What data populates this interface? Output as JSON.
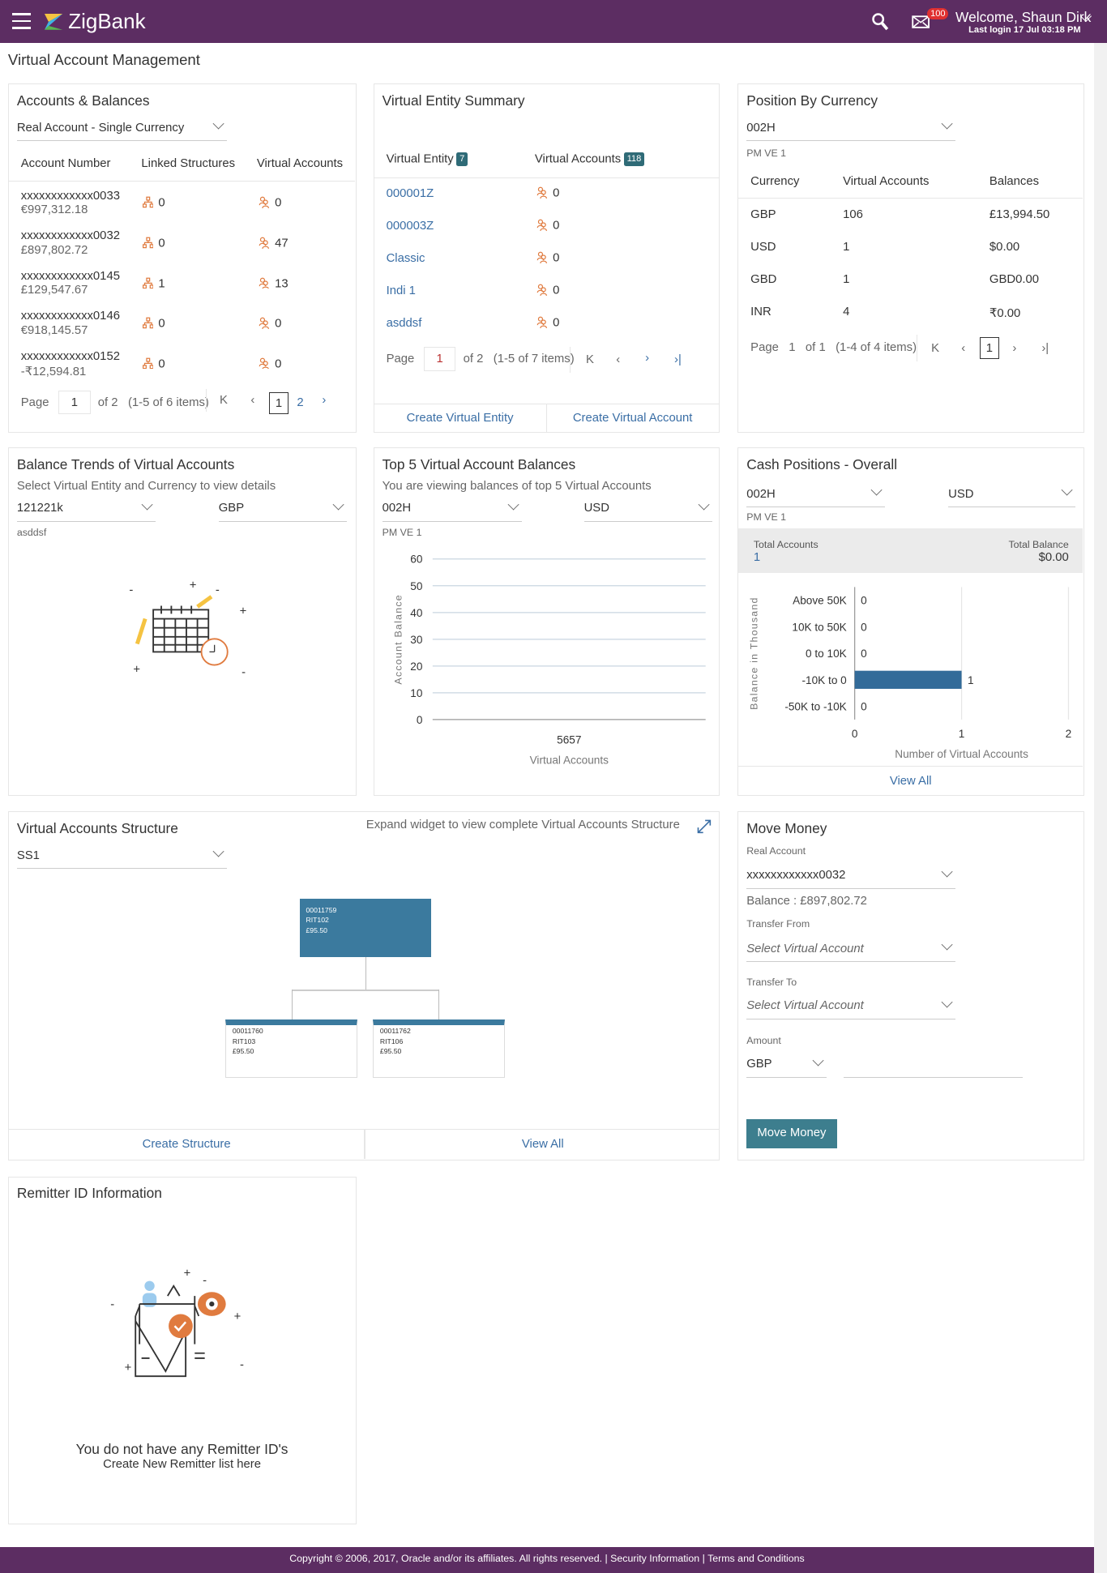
{
  "header": {
    "brand": "ZigBank",
    "welcome": "Welcome, Shaun Dirk",
    "last_login": "Last login 17 Jul 03:18 PM",
    "mail_badge": "100",
    "icons": [
      "menu-icon",
      "search-icon",
      "mail-icon",
      "chevron-down-icon"
    ]
  },
  "page_title": "Virtual Account Management",
  "colors": {
    "header": "#5c2d62",
    "accent": "#3d7e8e",
    "link": "#3a6ea5",
    "bar": "#336b99",
    "node": "#3b7a9e",
    "icon": "#e07b3f"
  },
  "accounts": {
    "title": "Accounts & Balances",
    "filter": "Real Account - Single Currency",
    "columns": [
      "Account Number",
      "Linked Structures",
      "Virtual Accounts"
    ],
    "rows": [
      {
        "account": "xxxxxxxxxxxx0033",
        "balance": "€997,312.18",
        "linked": "0",
        "virtual": "0"
      },
      {
        "account": "xxxxxxxxxxxx0032",
        "balance": "£897,802.72",
        "linked": "0",
        "virtual": "47"
      },
      {
        "account": "xxxxxxxxxxxx0145",
        "balance": "£129,547.67",
        "linked": "1",
        "virtual": "13"
      },
      {
        "account": "xxxxxxxxxxxx0146",
        "balance": "€918,145.57",
        "linked": "0",
        "virtual": "0"
      },
      {
        "account": "xxxxxxxxxxxx0152",
        "balance": "-₹12,594.81",
        "linked": "0",
        "virtual": "0"
      }
    ],
    "pager": {
      "label": "Page",
      "page": "1",
      "of": "of 2",
      "items": "(1-5 of 6 items)",
      "pages": [
        "1",
        "2"
      ]
    }
  },
  "entity": {
    "title": "Virtual Entity Summary",
    "col1": "Virtual Entity",
    "col1_count": "7",
    "col2": "Virtual Accounts",
    "col2_count": "118",
    "rows": [
      {
        "name": "000001Z",
        "count": "0"
      },
      {
        "name": "000003Z",
        "count": "0"
      },
      {
        "name": "Classic",
        "count": "0"
      },
      {
        "name": "Indi 1",
        "count": "0"
      },
      {
        "name": "asddsf",
        "count": "0"
      }
    ],
    "pager": {
      "label": "Page",
      "page": "1",
      "of": "of 2",
      "items": "(1-5 of 7 items)"
    },
    "create_entity": "Create Virtual Entity",
    "create_account": "Create Virtual Account"
  },
  "position": {
    "title": "Position By Currency",
    "entity": "002H",
    "entity_sub": "PM VE 1",
    "columns": [
      "Currency",
      "Virtual Accounts",
      "Balances"
    ],
    "rows": [
      {
        "currency": "GBP",
        "count": "106",
        "balance": "£13,994.50"
      },
      {
        "currency": "USD",
        "count": "1",
        "balance": "$0.00"
      },
      {
        "currency": "GBD",
        "count": "1",
        "balance": "GBD0.00"
      },
      {
        "currency": "INR",
        "count": "4",
        "balance": "₹0.00"
      }
    ],
    "pager": {
      "label": "Page",
      "page": "1",
      "of": "of 1",
      "items": "(1-4 of 4 items)",
      "current": "1"
    }
  },
  "trends": {
    "title": "Balance Trends of Virtual Accounts",
    "subtitle": "Select Virtual Entity and Currency to view details",
    "entity": "121221k",
    "currency": "GBP",
    "entity_sub": "asddsf"
  },
  "top5": {
    "title": "Top 5 Virtual Account Balances",
    "subtitle": "You are viewing balances of top 5 Virtual Accounts",
    "entity": "002H",
    "currency": "USD",
    "entity_sub": "PM VE 1"
  },
  "cash": {
    "title": "Cash Positions - Overall",
    "entity": "002H",
    "currency": "USD",
    "entity_sub": "PM VE 1",
    "total_accounts_label": "Total Accounts",
    "total_accounts": "1",
    "total_balance_label": "Total Balance",
    "total_balance": "$0.00",
    "view_all": "View All"
  },
  "chart_data": [
    {
      "type": "bar",
      "categories": [
        "5657"
      ],
      "values": [
        0
      ],
      "xlabel": "Virtual Accounts",
      "ylabel": "Account Balance",
      "ylim": [
        0,
        60
      ],
      "yticks": [
        "0",
        "10",
        "20",
        "30",
        "40",
        "50",
        "60"
      ],
      "grid": true
    },
    {
      "type": "bar",
      "orientation": "horizontal",
      "categories": [
        "Above 50K",
        "10K to 50K",
        "0 to 10K",
        "-10K to 0",
        "-50K to -10K"
      ],
      "values": [
        0,
        0,
        0,
        1,
        0
      ],
      "xlabel": "Number of Virtual Accounts",
      "ylabel": "Balance in Thousand",
      "xlim": [
        0,
        2
      ],
      "xticks": [
        "0",
        "1",
        "2"
      ],
      "grid": true
    }
  ],
  "structure": {
    "title": "Virtual Accounts Structure",
    "hint": "Expand widget to view complete Virtual Accounts Structure",
    "selected": "SS1",
    "root": {
      "id": "00011759",
      "code": "RIT102",
      "amount": "£95.50"
    },
    "children": [
      {
        "id": "00011760",
        "code": "RIT103",
        "amount": "£95.50"
      },
      {
        "id": "00011762",
        "code": "RIT106",
        "amount": "£95.50"
      }
    ],
    "create": "Create Structure",
    "view_all": "View All"
  },
  "move": {
    "title": "Move Money",
    "real_label": "Real Account",
    "real_value": "xxxxxxxxxxxx0032",
    "balance": "Balance : £897,802.72",
    "from_label": "Transfer From",
    "from_placeholder": "Select Virtual Account",
    "to_label": "Transfer To",
    "to_placeholder": "Select Virtual Account",
    "amount_label": "Amount",
    "currency": "GBP",
    "amount": "",
    "button": "Move Money"
  },
  "remitter": {
    "title": "Remitter ID Information",
    "empty": "You do not have any Remitter ID's",
    "create": "Create New Remitter list here"
  },
  "footer": {
    "copyright": "Copyright © 2006, 2017, Oracle and/or its affiliates. All rights reserved.",
    "security": "Security Information",
    "terms": "Terms and Conditions"
  }
}
